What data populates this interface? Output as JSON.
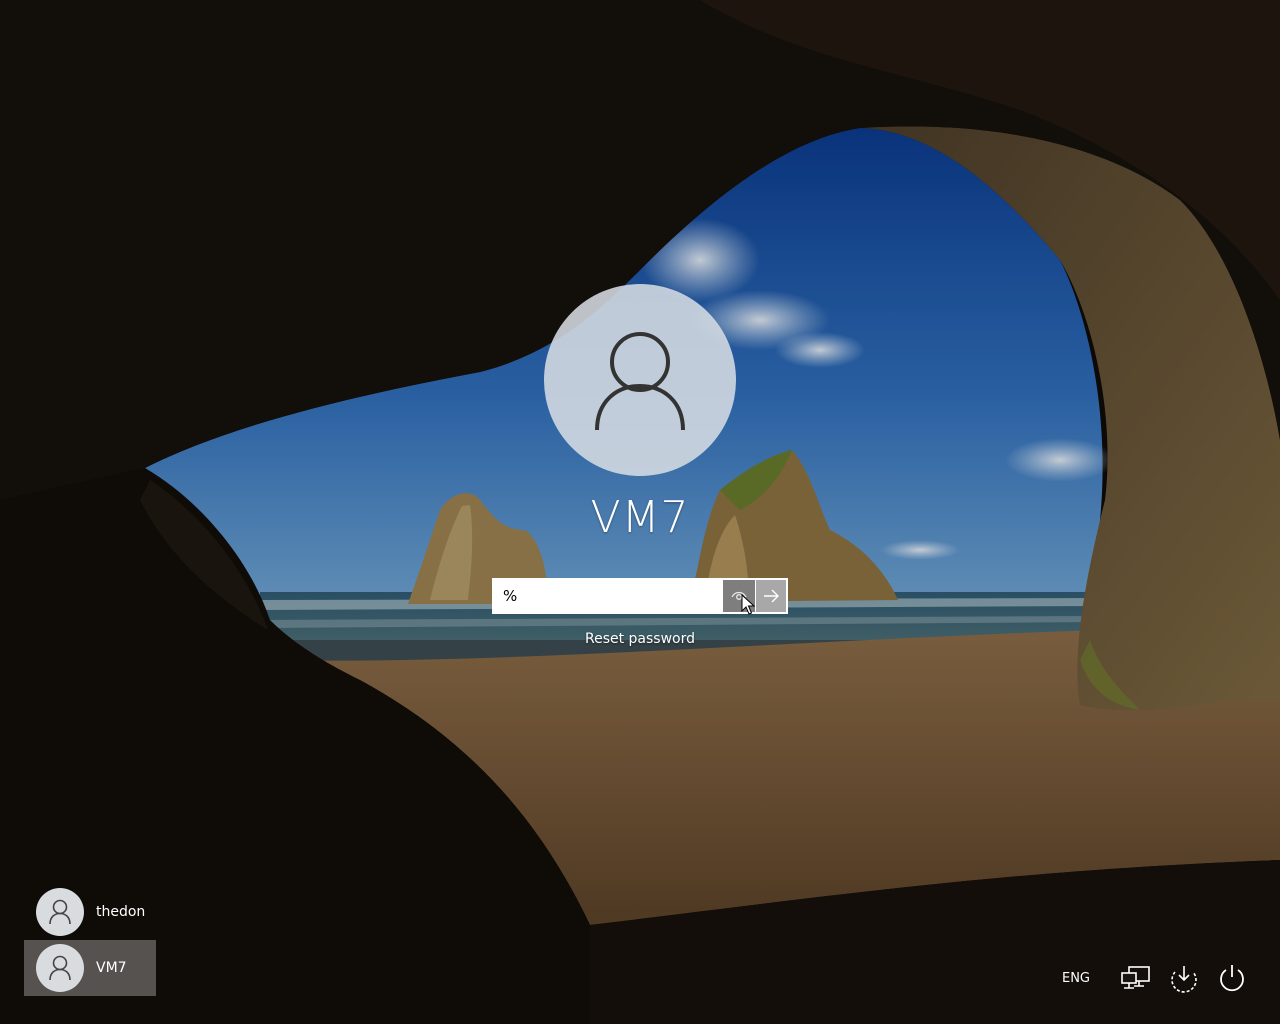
{
  "login": {
    "username": "VM7",
    "password_value": "%",
    "reset_password_label": "Reset password"
  },
  "user_list": [
    {
      "name": "thedon",
      "selected": false
    },
    {
      "name": "VM7",
      "selected": true
    }
  ],
  "tray": {
    "language": "ENG",
    "icons": [
      "network-icon",
      "ease-of-access-icon",
      "power-icon"
    ]
  },
  "icons": {
    "avatar": "person-icon",
    "reveal": "eye-icon",
    "submit": "arrow-right-icon"
  }
}
